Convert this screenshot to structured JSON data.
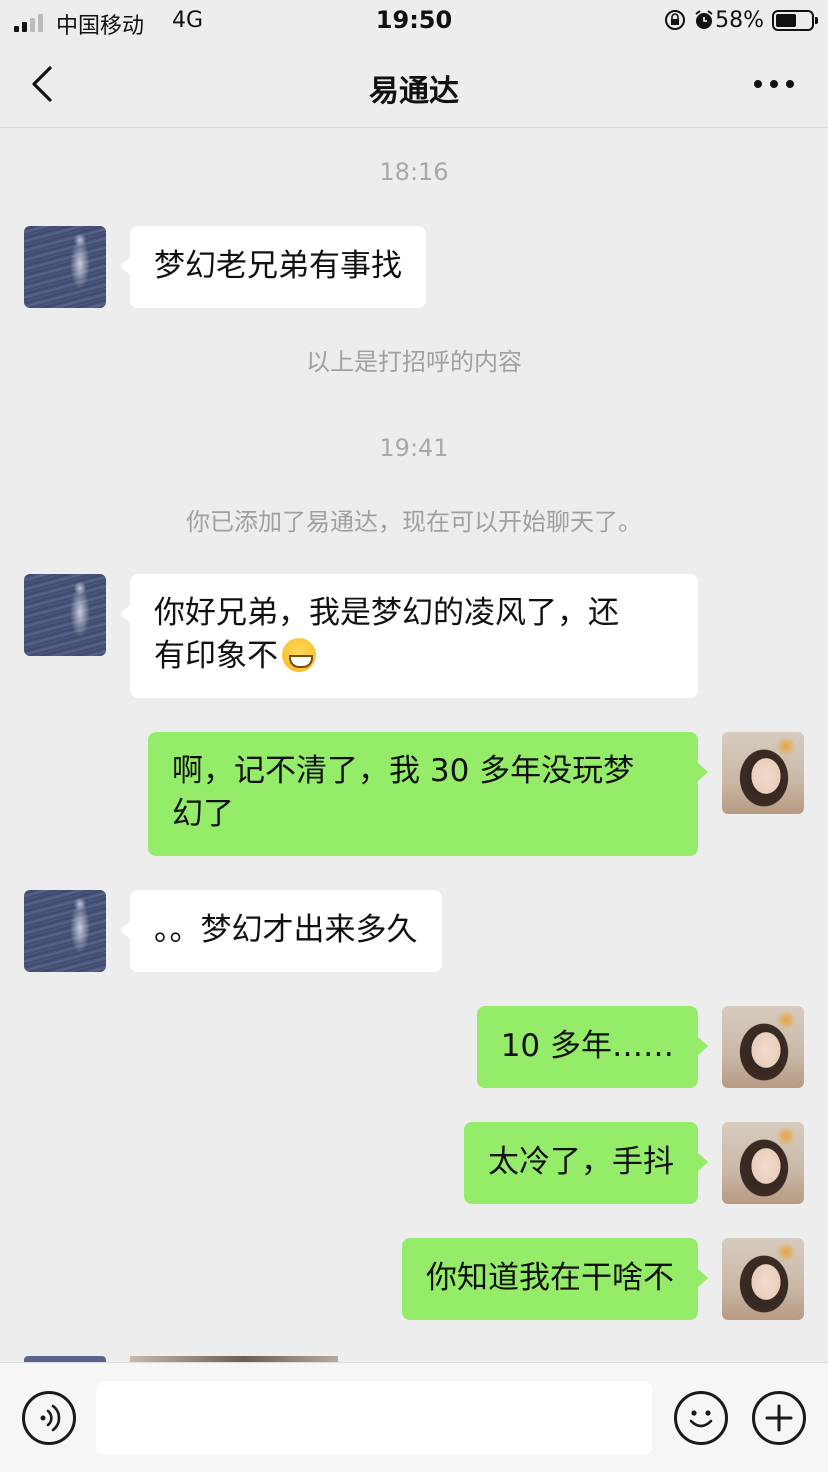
{
  "status_bar": {
    "carrier": "中国移动",
    "network": "4G",
    "time": "19:50",
    "battery_percent": "58%",
    "battery_level": 0.58,
    "icons": [
      "signal-icon",
      "rotation-lock-icon",
      "alarm-icon",
      "battery-icon"
    ]
  },
  "nav": {
    "title": "易通达",
    "back_icon": "chevron-left-icon",
    "more_icon": "more-dots-icon"
  },
  "chat": {
    "time_1": "18:16",
    "msg_1": "梦幻老兄弟有事找",
    "system_1": "以上是打招呼的内容",
    "time_2": "19:41",
    "system_2": "你已添加了易通达，现在可以开始聊天了。",
    "msg_2_line1": "你好兄弟，我是梦幻的凌风了，还",
    "msg_2_line2": "有印象不",
    "msg_2_emoji": "grinning-face-emoji",
    "msg_3_line1": "啊，记不清了，我 30 多年没玩梦",
    "msg_3_line2": "幻了",
    "msg_4": "。。梦幻才出来多久",
    "msg_5": "10 多年……",
    "msg_6": "太冷了，手抖",
    "msg_7": "你知道我在干啥不"
  },
  "input_bar": {
    "voice_icon": "voice-icon",
    "emoji_icon": "emoji-icon",
    "plus_icon": "plus-icon",
    "input_value": ""
  },
  "colors": {
    "background": "#ededed",
    "bubble_self": "#95ec69",
    "bubble_other": "#ffffff",
    "timestamp_text": "#a8a8a8"
  }
}
